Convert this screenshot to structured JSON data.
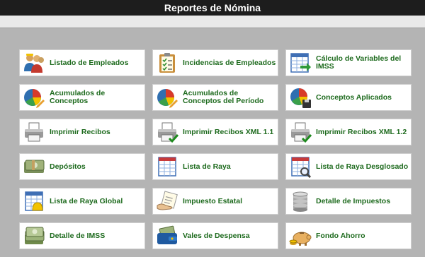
{
  "header": {
    "title": "Reportes de Nómina"
  },
  "reports": [
    {
      "label": "Listado de Empleados",
      "icon": "employees-icon"
    },
    {
      "label": "Incidencias de Empleados",
      "icon": "clipboard-checklist-icon"
    },
    {
      "label": "Cálculo de Variables del IMSS",
      "icon": "spreadsheet-arrow-icon"
    },
    {
      "label": "Acumulados de Conceptos",
      "icon": "pie-chart-pencil-icon"
    },
    {
      "label": "Acumulados de Conceptos del Período",
      "icon": "pie-chart-pencil-icon"
    },
    {
      "label": "Conceptos Aplicados",
      "icon": "pie-chart-disk-icon"
    },
    {
      "label": "Imprimir Recibos",
      "icon": "printer-icon"
    },
    {
      "label": "Imprimir Recibos XML 1.1",
      "icon": "printer-check-icon"
    },
    {
      "label": "Imprimir Recibos XML 1.2",
      "icon": "printer-check-icon"
    },
    {
      "label": "Depósitos",
      "icon": "money-bundle-icon"
    },
    {
      "label": "Lista de Raya",
      "icon": "calendar-sheet-icon"
    },
    {
      "label": "Lista de Raya Desglosado",
      "icon": "calendar-magnifier-icon"
    },
    {
      "label": "Lista de Raya Global",
      "icon": "calendar-bell-icon"
    },
    {
      "label": "Impuesto Estatal",
      "icon": "hand-document-icon"
    },
    {
      "label": "Detalle de Impuestos",
      "icon": "coin-stack-icon"
    },
    {
      "label": "Detalle de IMSS",
      "icon": "money-stack-icon"
    },
    {
      "label": "Vales de Despensa",
      "icon": "wallet-money-icon"
    },
    {
      "label": "Fondo Ahorro",
      "icon": "piggy-bank-coins-icon"
    }
  ]
}
